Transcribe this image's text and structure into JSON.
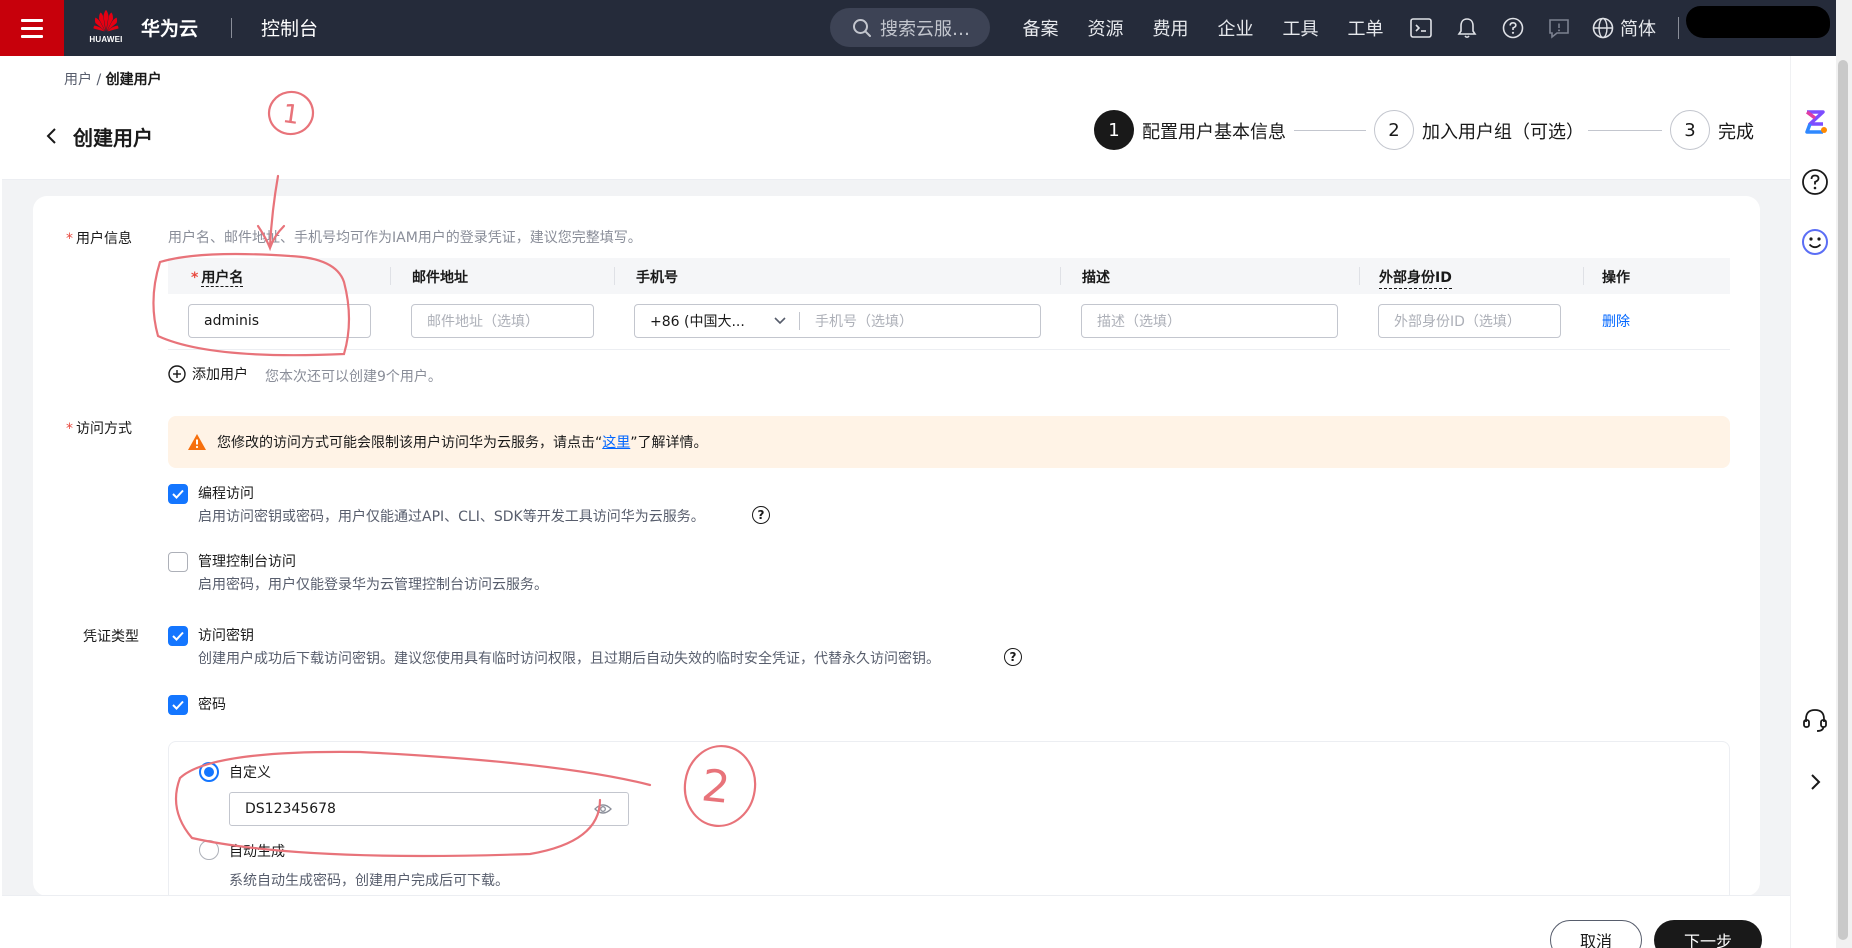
{
  "topbar": {
    "logo_text": "HUAWEI",
    "brand": "华为云",
    "console": "控制台",
    "search_placeholder": "搜索云服…",
    "nav": [
      "备案",
      "资源",
      "费用",
      "企业",
      "工具",
      "工单"
    ],
    "lang": "简体",
    "icons": [
      "terminal-icon",
      "bell-icon",
      "help-icon",
      "feedback-icon",
      "globe-icon"
    ]
  },
  "breadcrumb": {
    "parent": "用户",
    "separator": "/",
    "current": "创建用户"
  },
  "page_title": "创建用户",
  "steps": [
    {
      "num": "1",
      "label": "配置用户基本信息",
      "active": true
    },
    {
      "num": "2",
      "label": "加入用户组（可选）",
      "active": false
    },
    {
      "num": "3",
      "label": "完成",
      "active": false
    }
  ],
  "user_info": {
    "label": "用户信息",
    "hint": "用户名、邮件地址、手机号均可作为IAM用户的登录凭证，建议您完整填写。",
    "columns": {
      "username": "用户名",
      "email": "邮件地址",
      "phone": "手机号",
      "desc": "描述",
      "external_id": "外部身份ID",
      "action": "操作"
    },
    "row": {
      "username": "adminis",
      "email_placeholder": "邮件地址（选填）",
      "country_code": "+86 (中国大...",
      "phone_placeholder": "手机号（选填）",
      "desc_placeholder": "描述（选填）",
      "external_id_placeholder": "外部身份ID（选填）",
      "delete": "删除"
    },
    "add_user": "添加用户",
    "add_hint": "您本次还可以创建9个用户。"
  },
  "access": {
    "label": "访问方式",
    "notice_prefix": "您修改的访问方式可能会限制该用户访问华为云服务，请点击“",
    "notice_link": "这里",
    "notice_suffix": "”了解详情。",
    "programmatic": {
      "title": "编程访问",
      "desc": "启用访问密钥或密码，用户仅能通过API、CLI、SDK等开发工具访问华为云服务。",
      "checked": true
    },
    "console": {
      "title": "管理控制台访问",
      "desc": "启用密码，用户仅能登录华为云管理控制台访问云服务。",
      "checked": false
    }
  },
  "credential": {
    "label": "凭证类型",
    "access_key": {
      "title": "访问密钥",
      "desc": "创建用户成功后下载访问密钥。建议您使用具有临时访问权限，且过期后自动失效的临时安全凭证，代替永久访问密钥。",
      "checked": true
    },
    "password": {
      "title": "密码",
      "checked": true
    },
    "custom": {
      "label": "自定义",
      "value": "DS12345678",
      "selected": true
    },
    "auto": {
      "label": "自动生成",
      "desc": "系统自动生成密码，创建用户完成后可下载。",
      "selected": false
    }
  },
  "footer": {
    "cancel": "取消",
    "next": "下一步"
  },
  "annotations": {
    "mark1": "1",
    "mark2": "2"
  },
  "colors": {
    "topbar": "#252b3a",
    "menu_red": "#c7000b",
    "primary": "#1476ff",
    "link": "#0066ff",
    "notice_bg": "#fff3e6",
    "annotation": "#e8737a"
  }
}
